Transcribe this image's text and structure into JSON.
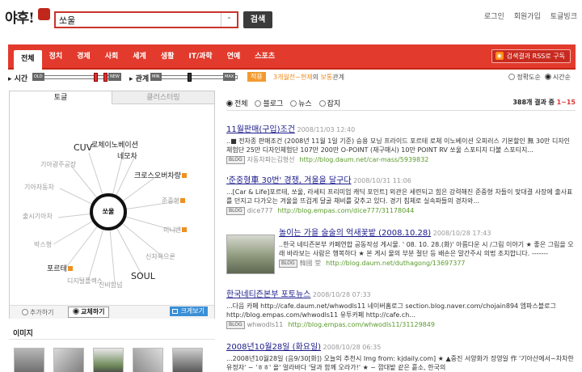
{
  "header": {
    "logo_text": "야후!",
    "search_value": "쏘울",
    "search_button": "검색",
    "top_links": [
      "로그인",
      "회원가입",
      "토글빙크"
    ]
  },
  "nav": {
    "tabs": [
      "전체",
      "정치",
      "경제",
      "사회",
      "세계",
      "생활",
      "IT/과학",
      "연예",
      "스포츠"
    ],
    "rss_label": "검색결과 RSS로 구독",
    "accent": "#e23b2d"
  },
  "filters": {
    "time_label": "▸ 시간",
    "relation_label": "▸ 관계",
    "apply_label": "적용",
    "summary_strong": "3개월전~현재",
    "summary_mid": "의 ",
    "summary_topic": "보통",
    "summary_end": "관계",
    "sort_options": [
      "정확도순",
      "시간순"
    ],
    "sort_selected": "시간순",
    "slider_min_label": "MIN",
    "slider_max_label": "MAX",
    "time_left_label": "OLD",
    "time_right_label": "NEW"
  },
  "keyword_panel": {
    "tabs": [
      "토글",
      "클러스터링"
    ],
    "center": "쏘울",
    "keywords": [
      {
        "text": "CUV",
        "size": "big"
      },
      {
        "text": "로체이노베이션",
        "size": "mid"
      },
      {
        "text": "네모차",
        "size": "mid"
      },
      {
        "text": "기아광주공장",
        "size": "small"
      },
      {
        "text": "크로스오버차량",
        "size": "mid"
      },
      {
        "text": "기아자동차",
        "size": "small"
      },
      {
        "text": "준중형",
        "size": "small"
      },
      {
        "text": "출시기아차",
        "size": "small"
      },
      {
        "text": "미니밴",
        "size": "small"
      },
      {
        "text": "박스형",
        "size": "small"
      },
      {
        "text": "신차욕으론",
        "size": "small"
      },
      {
        "text": "포르테",
        "size": "mid"
      },
      {
        "text": "SOUL",
        "size": "big"
      },
      {
        "text": "디지털플렉스",
        "size": "small"
      },
      {
        "text": "신비함넘",
        "size": "small"
      }
    ],
    "footer": {
      "add": "추가하기",
      "replace": "교체하기",
      "enlarge": "크게보기"
    }
  },
  "images_section": {
    "title": "이미지"
  },
  "results_head": {
    "filters": [
      "전체",
      "블로그",
      "뉴스",
      "잡지"
    ],
    "selected": "전체",
    "count_text": "388개 결과 중",
    "range": "1~15"
  },
  "results": [
    {
      "title": "11월판매(구입)조건",
      "date": " 2008/11/03 12:40",
      "snippet": "..■ 전차종 판매조건 (2008년 11월 1일 기준) 승용 모닝 프라이드 포르테 로체 이노베이션 오피러스 기본할인 無 30만 디자인 체험단 25만 디자인체험단 107만 200만 O-POINT (재구매시) 10만 POINT RV 쏘울 스포티지 다불 스포티지...",
      "author": "자동차파는김형선",
      "url": "http://blog.daum.net/car-mass/5939832",
      "has_image": false
    },
    {
      "title": "'준중형車 30번' 경쟁, 겨울을 달구다",
      "date": " 2008/10/31 11:06",
      "snippet": "...[Car & Life]포르테, 쏘울, 라세티 프리미엄 캐딕 포인트] 외관은 세련되고 힘은 강력해진 준중형 차들이 맞대결 사장에 출사표를 던지고 다가오는 겨울을 뜨겁게 달굴 채비를 갖추고 있다. 경기 침체로 실속파들의 경차와...",
      "author": "dice777",
      "url": "http://blog.empas.com/dice777/31178044",
      "has_image": false
    },
    {
      "title": "놀이는 가을 술술의 억새꽃밭 (2008.10.28)",
      "date": " 2008/10/28 17:43",
      "snippet": "..한국 네티즌본부 카페연합 공동작성 게시물. ' 08. 10. 28.(화)' 아름다운 시 /그림 이야기 ★ 좋은 그림을 오래 바라보는 사람은 행복하다 ★ 본 게시 물의 부분 절단 등 배손은 말간주시 의법 조치합니다. -------",
      "author": "韓國 堂",
      "url": "http://blog.daum.net/duthagong/13697377",
      "has_image": true
    },
    {
      "title": "한국네티즌본부 포토뉴스",
      "date": " 2008/10/28 07:33",
      "snippet": "...다음 카페 http://cafe.daum.net/whwodls11 네이버홈로그 section.blog.naver.com/chojain894 엠파스블로그 http://blog.empas.com/whwodls11 유투카페 http://cafe.ch...",
      "author": "whwodls11",
      "url": "http://blog.empas.com/whwodls11/31129849",
      "has_image": false
    },
    {
      "title": "2008년10월28일 (화요일)",
      "date": " 2008/10/28 06:35",
      "snippet": "...2008년10월28일 (음9/30[화]) 오늘의 추천시 Img from: kjdaily.com] ★ ▲중진 서양화가 장영일 作 '기아산에서~차차한 유정자' ~ 'ㅎㅎ' 올' 얼라바다 '달과 함께 오라가!' ★ ~ 깜대밭 같은 흩소, 한국의",
      "author": "",
      "url": "",
      "has_image": false
    }
  ]
}
